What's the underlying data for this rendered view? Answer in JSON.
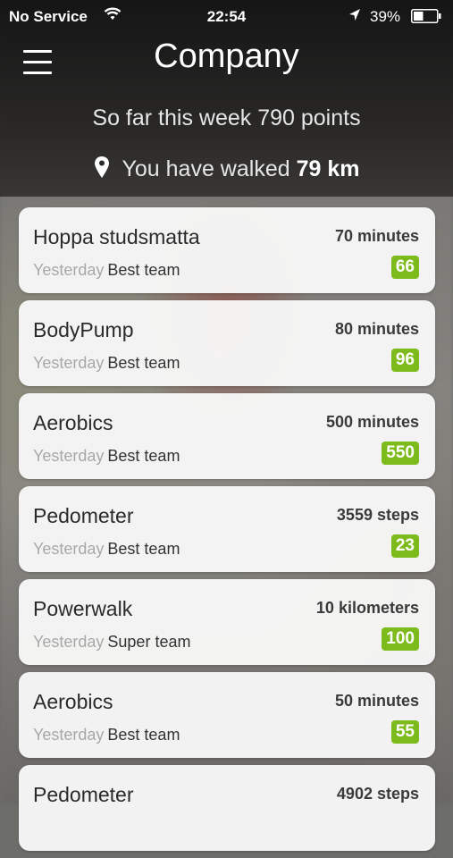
{
  "status_bar": {
    "carrier": "No Service",
    "time": "22:54",
    "battery": "39%",
    "icons": [
      "wifi-icon",
      "location-arrow-icon",
      "battery-icon"
    ]
  },
  "header": {
    "title": "Company",
    "menu_icon": "hamburger-menu-icon",
    "summary": "So far this week 790 points",
    "walked_label": "You have walked",
    "walked_value": "79 km",
    "pin_icon": "map-pin-icon"
  },
  "activities": [
    {
      "name": "Hoppa studsmatta",
      "when": "Yesterday",
      "team": "Best team",
      "quantity": "70 minutes",
      "points": "66"
    },
    {
      "name": "BodyPump",
      "when": "Yesterday",
      "team": "Best team",
      "quantity": "80 minutes",
      "points": "96"
    },
    {
      "name": "Aerobics",
      "when": "Yesterday",
      "team": "Best team",
      "quantity": "500 minutes",
      "points": "550"
    },
    {
      "name": "Pedometer",
      "when": "Yesterday",
      "team": "Best team",
      "quantity": "3559 steps",
      "points": "23"
    },
    {
      "name": "Powerwalk",
      "when": "Yesterday",
      "team": "Super team",
      "quantity": "10 kilometers",
      "points": "100"
    },
    {
      "name": "Aerobics",
      "when": "Yesterday",
      "team": "Best team",
      "quantity": "50 minutes",
      "points": "55"
    },
    {
      "name": "Pedometer",
      "when": "",
      "team": "",
      "quantity": "4902 steps",
      "points": ""
    }
  ],
  "colors": {
    "badge_green": "#7dbb1c",
    "header_dark": "#1e1e1e"
  }
}
